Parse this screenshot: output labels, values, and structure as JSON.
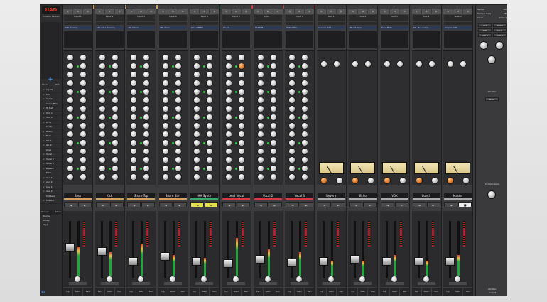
{
  "app": {
    "logo": "UAD",
    "session": "Console Session",
    "browser_header": [
      "Show",
      "Hide"
    ],
    "channel_list": [
      "Inputs",
      "Kick",
      "Snare",
      "Snare Btm",
      "Hi Hat",
      "Tom 1",
      "Tom 2",
      "OH L",
      "OH R",
      "Room",
      "Bass",
      "Gtr 1",
      "Gtr 2",
      "Keys",
      "Vocal 1",
      "Vocal 2",
      "Vocal 3",
      "Reverb",
      "Echo",
      "Aux 1",
      "Aux 2",
      "Cue 1",
      "Cue 2",
      "Talkback",
      "Monitor"
    ],
    "groups_header": [
      "Groups",
      "Show"
    ],
    "groups": [
      "Drums",
      "Vocals",
      "Keys"
    ]
  },
  "groups_top": [
    {
      "label": "Drums",
      "color": "#d4a05a"
    },
    {
      "label": "Instruments",
      "color": "#3aaa6a"
    },
    {
      "label": "Vocals",
      "color": "#d83a3a"
    }
  ],
  "strip_buttons": [
    "S",
    "M",
    "R"
  ],
  "channels": [
    {
      "name": "Bass",
      "color": "#d4a05a",
      "input": "Input 1",
      "insert": "V76 Preamp",
      "btn1": "◄",
      "btn2": "►",
      "type": "input",
      "fader": 0.55,
      "level": 0.55
    },
    {
      "name": "Kick",
      "color": "#d4a05a",
      "input": "Input 2",
      "insert": "610 Tube Preamp",
      "btn1": "◄",
      "btn2": "►",
      "type": "input",
      "fader": 0.45,
      "level": 0.45
    },
    {
      "name": "Snare Top",
      "color": "#d4a05a",
      "input": "Input 3",
      "insert": "API Vision",
      "btn1": "◄",
      "btn2": "►",
      "type": "input",
      "fader": 0.25,
      "level": 0.6
    },
    {
      "name": "Snare Btm",
      "color": "#d4a05a",
      "input": "Input 4",
      "insert": "API Vision",
      "btn1": "◄",
      "btn2": "►",
      "type": "input",
      "fader": 0.35,
      "level": 0.4
    },
    {
      "name": "HH Synth",
      "color": "#3aaa6a",
      "input": "Input 5",
      "insert": "Neve 88RS",
      "btn1": "◄",
      "btn2": "►",
      "type": "input",
      "fader": 0.25,
      "level": 0.35,
      "hl": true
    },
    {
      "name": "Lead Vocal",
      "color": "#d83a3a",
      "input": "Input 6",
      "insert": "LA-2A",
      "btn1": "◄",
      "btn2": "►",
      "type": "input",
      "fader": 0.2,
      "level": 0.7
    },
    {
      "name": "Vocal 2",
      "color": "#d83a3a",
      "input": "Input 7",
      "insert": "1176LN",
      "btn1": "◄",
      "btn2": "►",
      "type": "input",
      "fader": 0.3,
      "level": 0.5
    },
    {
      "name": "Vocal 3",
      "color": "#d83a3a",
      "input": "Input 8",
      "insert": "Pultec EQ",
      "btn1": "◄",
      "btn2": "►",
      "type": "input",
      "fader": 0.22,
      "level": 0.45
    },
    {
      "name": "Reverb",
      "color": "#aaaaaa",
      "input": "Aux 1",
      "insert": "Lexicon 224",
      "btn1": "◄",
      "btn2": "►",
      "type": "aux",
      "fader": 0.25,
      "level": 0.3
    },
    {
      "name": "Echo",
      "color": "#aaaaaa",
      "input": "Aux 2",
      "insert": "EP-34 Tape",
      "btn1": "◄",
      "btn2": "►",
      "type": "aux",
      "fader": 0.3,
      "level": 0.3
    },
    {
      "name": "VOX",
      "color": "#aaaaaa",
      "input": "Aux 3",
      "insert": "Pure Plate",
      "btn1": "◄",
      "btn2": "►",
      "type": "aux",
      "fader": 0.25,
      "level": 0.4
    },
    {
      "name": "Punch",
      "color": "#aaaaaa",
      "input": "Aux 4",
      "insert": "SSL Bus Comp",
      "btn1": "◄",
      "btn2": "►",
      "type": "aux",
      "fader": 0.25,
      "level": 0.3
    },
    {
      "name": "Master",
      "color": "#aaaaaa",
      "input": "Master",
      "insert": "Ampex ATR",
      "btn1": "◄",
      "btn2": "■",
      "type": "master",
      "fader": 0.25,
      "level": 0.4
    }
  ],
  "bottom_labels": [
    "Inp",
    "Gain",
    "Pan"
  ],
  "output_label": "Output",
  "monitor": {
    "rows": [
      [
        "Tempo",
        "120"
      ],
      [
        "Sample Rate",
        "48k"
      ],
      [
        "Clock",
        "Internal"
      ]
    ],
    "buttons": [
      "ALT",
      "MONO",
      "DIM",
      "TALK",
      "CUE 1",
      "CUE 2"
    ],
    "labels": [
      "Monitor",
      "Mute",
      "Control Room"
    ],
    "footer": "Monitor"
  }
}
